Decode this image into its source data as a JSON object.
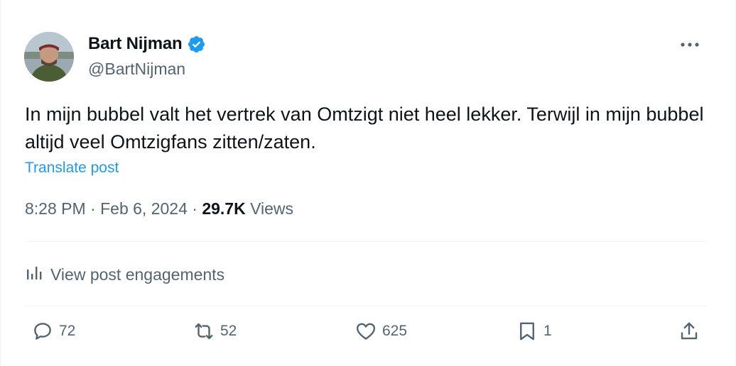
{
  "author": {
    "name": "Bart Nijman",
    "handle": "@BartNijman"
  },
  "post": {
    "text": "In mijn bubbel valt het vertrek van Omtzigt niet heel lekker. Terwijl in mijn bubbel altijd veel Omtzigfans zitten/zaten.",
    "translate_label": "Translate post"
  },
  "meta": {
    "time": "8:28 PM",
    "date": "Feb 6, 2024",
    "views_count": "29.7K",
    "views_label": "Views",
    "separator": "·"
  },
  "engagements_label": "View post engagements",
  "actions": {
    "replies": "72",
    "reposts": "52",
    "likes": "625",
    "bookmarks": "1"
  },
  "colors": {
    "link": "#1d9bf0",
    "secondary_text": "#536471",
    "primary_text": "#0f1419",
    "verified": "#1d9bf0"
  },
  "icons": {
    "verified": "verified-badge-icon",
    "more": "more-horizontal-icon",
    "engagements": "bar-chart-icon",
    "reply": "comment-bubble-icon",
    "repost": "repost-arrows-icon",
    "like": "heart-icon",
    "bookmark": "bookmark-icon",
    "share": "share-upload-icon"
  }
}
